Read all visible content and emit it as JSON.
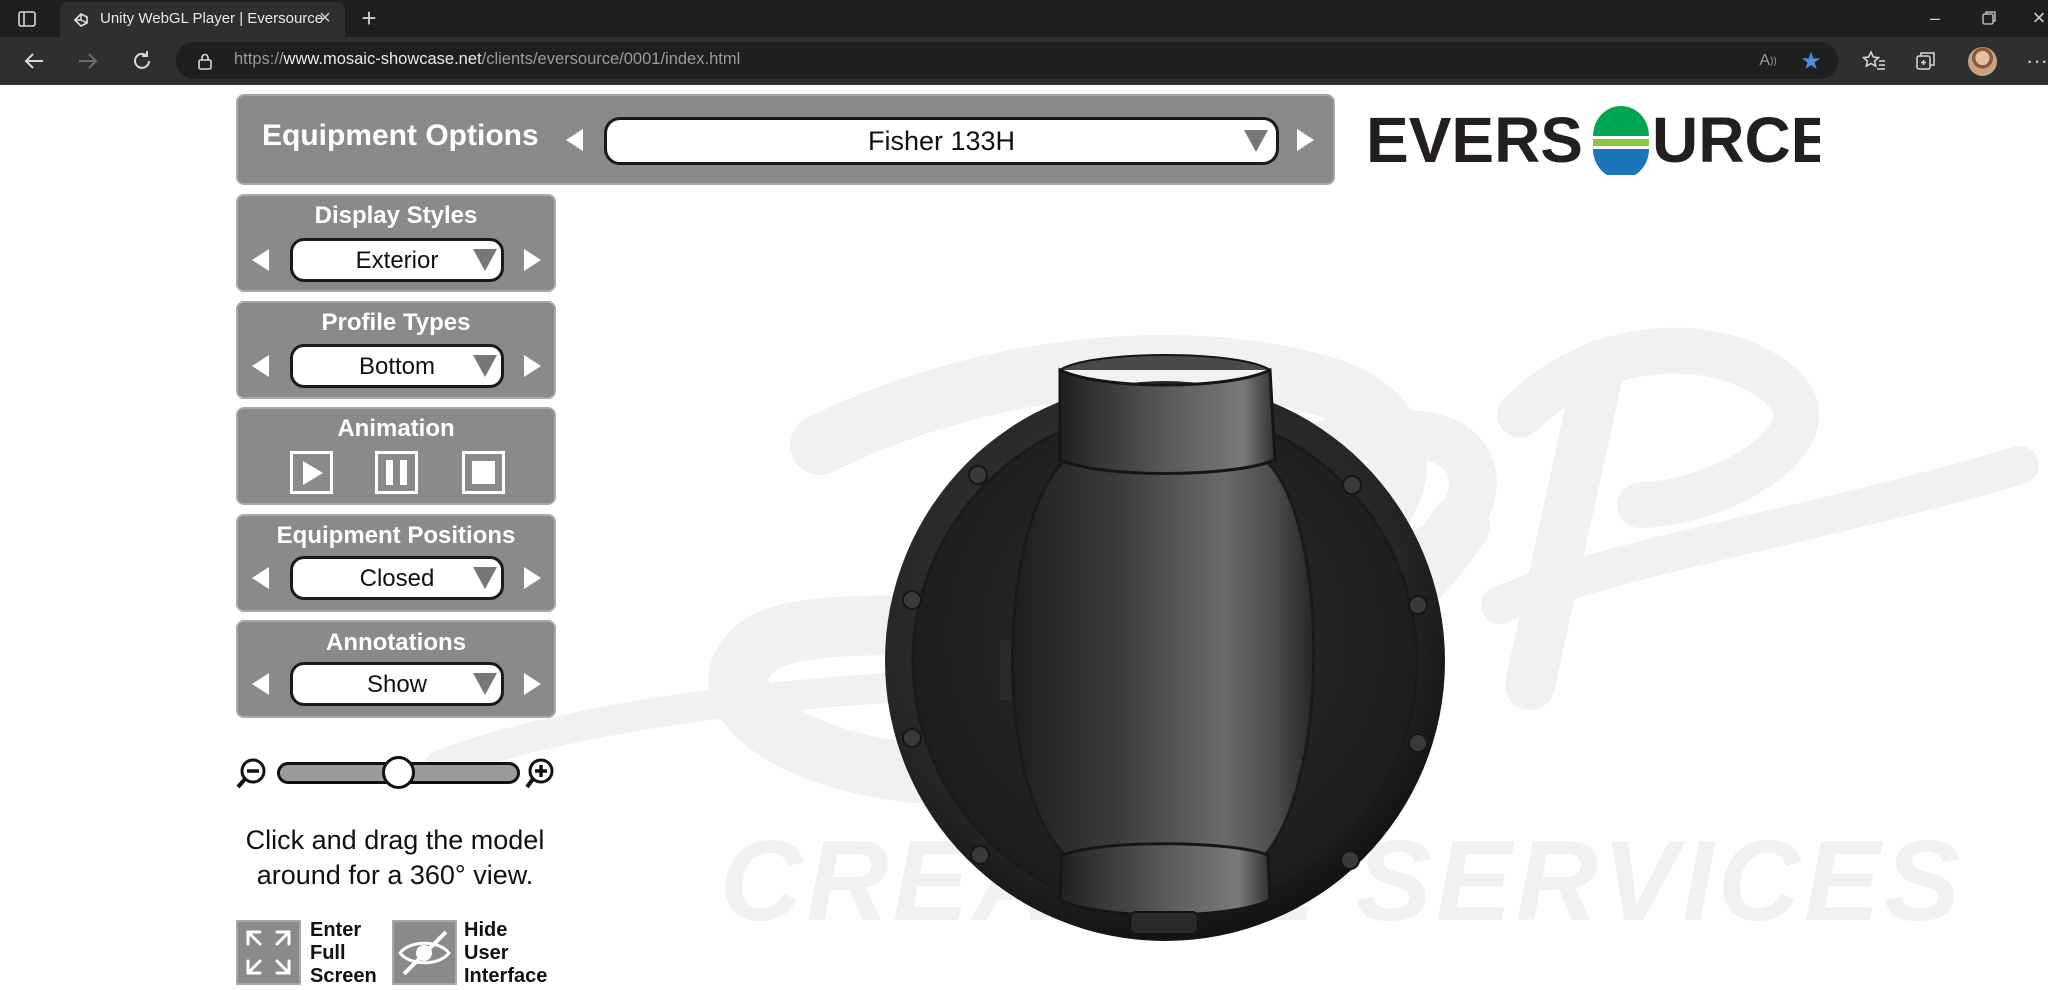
{
  "browser": {
    "tab_title": "Unity WebGL Player | Eversource",
    "url_prefix": "https://",
    "url_host": "www.mosaic-showcase.net",
    "url_path": "/clients/eversource/0001/index.html"
  },
  "header": {
    "title": "Equipment Options",
    "selected_equipment": "Fisher 133H",
    "logo_text": "EVERSOURCE"
  },
  "panels": {
    "display_styles": {
      "title": "Display Styles",
      "value": "Exterior"
    },
    "profile_types": {
      "title": "Profile Types",
      "value": "Bottom"
    },
    "animation": {
      "title": "Animation"
    },
    "equipment_positions": {
      "title": "Equipment Positions",
      "value": "Closed"
    },
    "annotations": {
      "title": "Annotations",
      "value": "Show"
    }
  },
  "zoom": {
    "level": 0.5
  },
  "help_text": "Click and drag the model around for a 360° view.",
  "tools": {
    "fullscreen_label_1": "Enter",
    "fullscreen_label_2": "Full",
    "fullscreen_label_3": "Screen",
    "hide_ui_label_1": "Hide",
    "hide_ui_label_2": "User",
    "hide_ui_label_3": "Interface"
  },
  "watermark": {
    "text": "CREATIVE SERVICES"
  },
  "colors": {
    "panel": "#8a8a8a",
    "logo_dark": "#231f20",
    "logo_green": "#00a651",
    "logo_blue": "#1b75bb"
  }
}
